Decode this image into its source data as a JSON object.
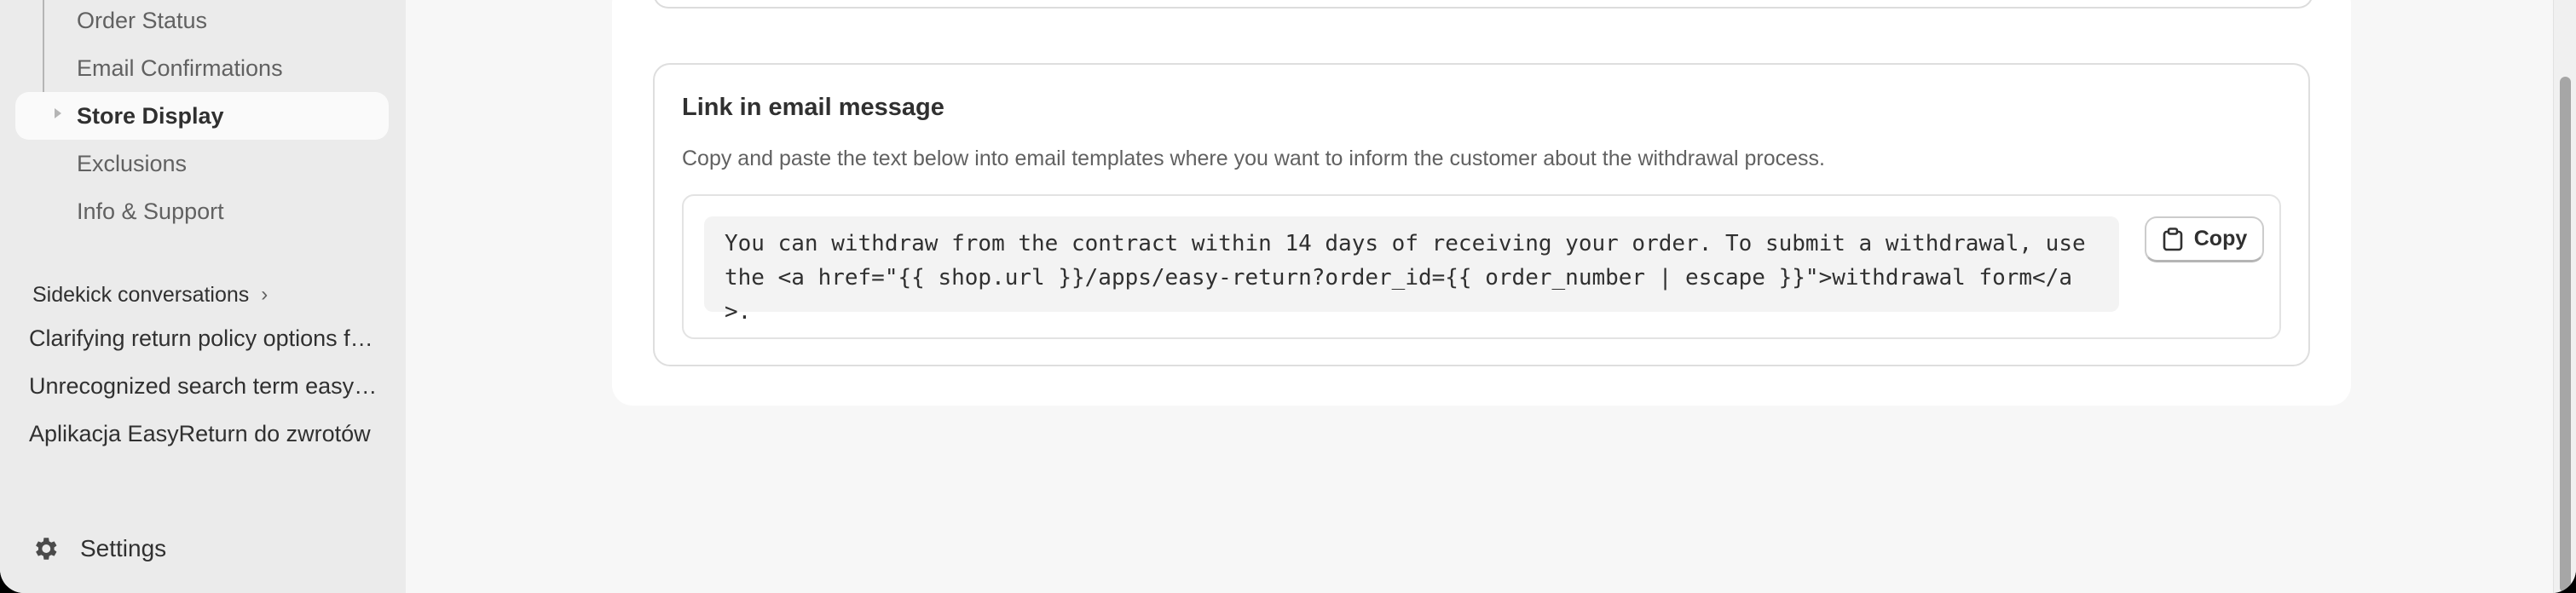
{
  "sidebar": {
    "nav_items": [
      {
        "label": "Order Status"
      },
      {
        "label": "Email Confirmations"
      },
      {
        "label": "Store Display"
      },
      {
        "label": "Exclusions"
      },
      {
        "label": "Info & Support"
      }
    ],
    "active_item": "Store Display",
    "sidekick_heading": "Sidekick conversations",
    "conversations": [
      {
        "title": "Clarifying return policy options for non-standard items"
      },
      {
        "title": "Unrecognized search term easyreturn"
      },
      {
        "title": "Aplikacja EasyReturn do zwrotów"
      }
    ],
    "settings_label": "Settings"
  },
  "main": {
    "card": {
      "title": "Link in email message",
      "description": "Copy and paste the text below into email templates where you want to inform the customer about the withdrawal process.",
      "code_text": "You can withdraw from the contract within 14 days of receiving your order. To submit a withdrawal, use the <a href=\"{{ shop.url }}/apps/easy-return?order_id={{ order_number | escape }}\">withdrawal form</a>.",
      "copy_button_label": "Copy"
    }
  },
  "colors": {
    "sidebar_bg": "#ebebeb",
    "main_bg": "#f7f7f7",
    "card_bg": "#ffffff",
    "text_primary": "#303030",
    "text_secondary": "#616161"
  }
}
